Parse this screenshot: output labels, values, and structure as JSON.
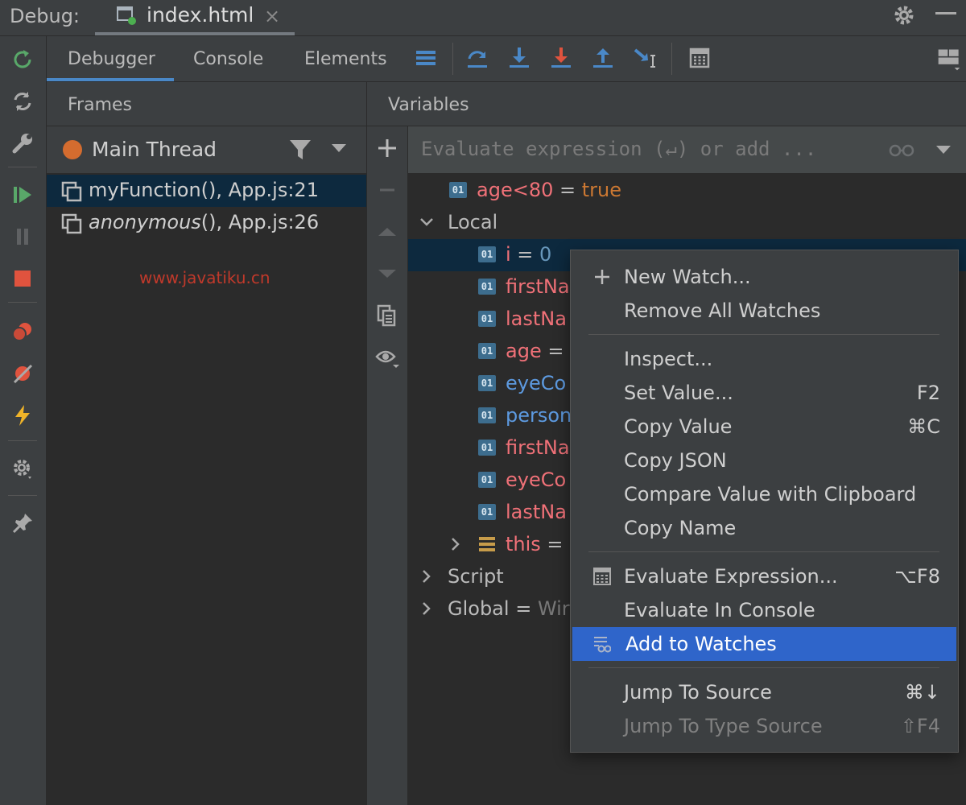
{
  "topbar": {
    "debug_label": "Debug:",
    "file_tab": "index.html",
    "close_glyph": "×"
  },
  "tabs": [
    {
      "label": "Debugger",
      "active": true
    },
    {
      "label": "Console",
      "active": false
    },
    {
      "label": "Elements",
      "active": false
    }
  ],
  "frames": {
    "title": "Frames",
    "thread": "Main Thread",
    "items": [
      {
        "name": "myFunction()",
        "location": ", App.js:21",
        "italic": false,
        "selected": true
      },
      {
        "name": "anonymous",
        "location": "(), App.js:26",
        "italic": true,
        "selected": false
      }
    ]
  },
  "watermark": "www.javatiku.cn",
  "variables": {
    "title": "Variables",
    "eval_placeholder": "Evaluate expression (↵) or add ...",
    "rows": [
      {
        "kind": "watch",
        "badge": "01",
        "name": "age<80",
        "eq": " = ",
        "value": "true"
      },
      {
        "kind": "group",
        "label": "Local",
        "expanded": true
      },
      {
        "kind": "var",
        "badge": "01",
        "name": "i",
        "eq": " = ",
        "value": "0",
        "selected": true
      },
      {
        "kind": "var",
        "badge": "01",
        "name": "firstNa"
      },
      {
        "kind": "var",
        "badge": "01",
        "name": "lastNa"
      },
      {
        "kind": "var",
        "badge": "01",
        "name": "age",
        "eq": " ="
      },
      {
        "kind": "var",
        "badge": "01",
        "name": "eyeCo",
        "blue": true
      },
      {
        "kind": "var",
        "badge": "01",
        "name": "person",
        "blue": true
      },
      {
        "kind": "var",
        "badge": "01",
        "name": "firstNa"
      },
      {
        "kind": "var",
        "badge": "01",
        "name": "eyeCo"
      },
      {
        "kind": "var",
        "badge": "01",
        "name": "lastNa"
      },
      {
        "kind": "this",
        "name": "this",
        "eq": " ="
      },
      {
        "kind": "group",
        "label": "Script",
        "expanded": false
      },
      {
        "kind": "group",
        "label": "Global",
        "eq": " = ",
        "value": "Wir",
        "expanded": false
      }
    ]
  },
  "context_menu": {
    "items": [
      {
        "label": "New Watch...",
        "icon": "plus-icon"
      },
      {
        "label": "Remove All Watches"
      },
      {
        "sep": true
      },
      {
        "label": "Inspect..."
      },
      {
        "label": "Set Value...",
        "shortcut": "F2"
      },
      {
        "label": "Copy Value",
        "shortcut": "⌘C"
      },
      {
        "label": "Copy JSON"
      },
      {
        "label": "Compare Value with Clipboard"
      },
      {
        "label": "Copy Name"
      },
      {
        "sep": true
      },
      {
        "label": "Evaluate Expression...",
        "shortcut": "⌥F8",
        "icon": "calculator-icon"
      },
      {
        "label": "Evaluate In Console"
      },
      {
        "label": "Add to Watches",
        "icon": "add-watch-icon",
        "active": true
      },
      {
        "sep": true
      },
      {
        "label": "Jump To Source",
        "shortcut": "⌘↓"
      },
      {
        "label": "Jump To Type Source",
        "shortcut": "⇧F4",
        "disabled": true
      }
    ]
  },
  "colors": {
    "background": "#3c3f41",
    "editor_background": "#2b2b2b",
    "selection": "#0d293e",
    "menu_highlight": "#2f65ca",
    "var_name": "#f07178",
    "var_name_blue": "#5d9ae0",
    "value_keyword": "#cc7832",
    "value_number": "#6897bb",
    "accent": "#4a88c7"
  }
}
